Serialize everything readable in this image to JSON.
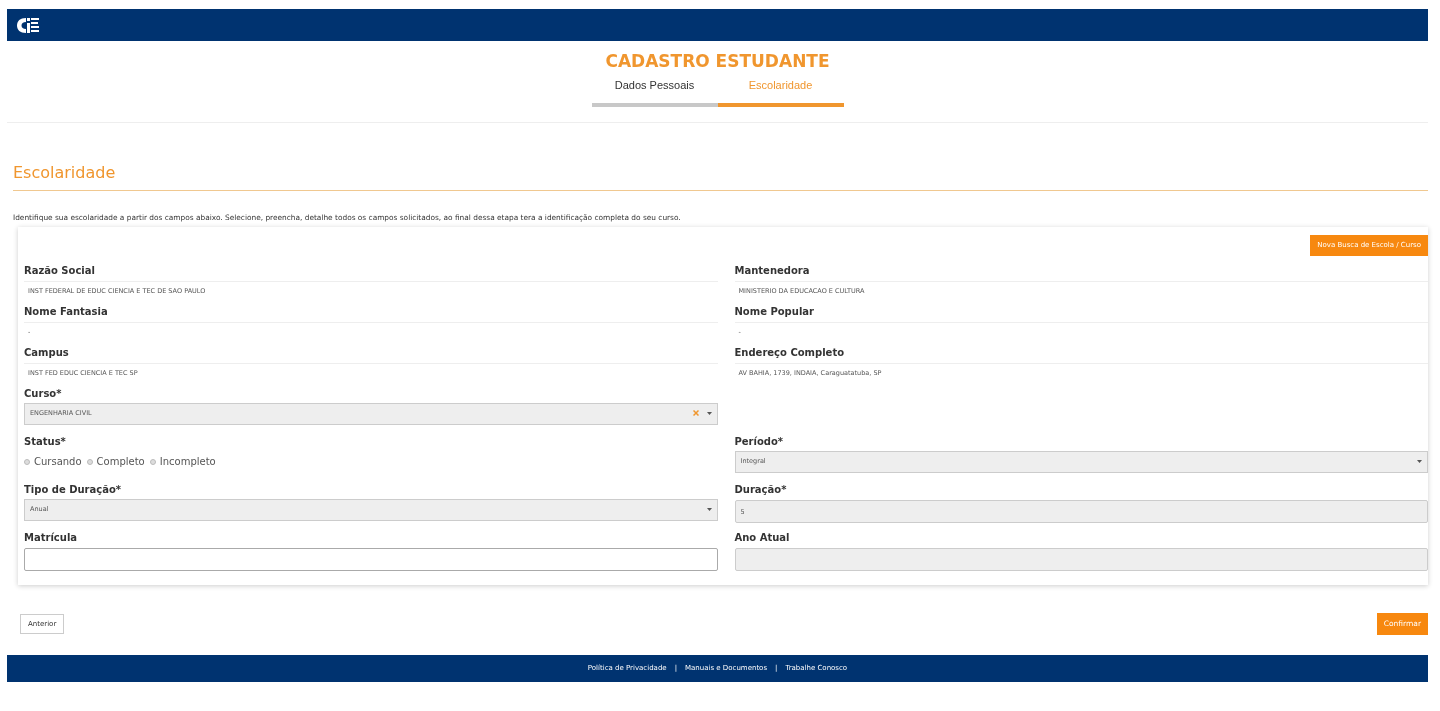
{
  "title": "CADASTRO ESTUDANTE",
  "steps": [
    {
      "label": "Dados Pessoais",
      "selected": false
    },
    {
      "label": "Escolaridade",
      "selected": true
    }
  ],
  "section_title": "Escolaridade",
  "intro": "Identifique sua escolaridade a partir dos campos abaixo. Selecione, preencha, detalhe todos os campos solicitados, ao final dessa etapa tera a identificação completa do seu curso.",
  "search_button": "Nova Busca de Escola / Curso",
  "rows": [
    [
      {
        "kind": "info",
        "label": "Razão Social",
        "value": "INST FEDERAL DE EDUC CIENCIA E TEC DE SAO PAULO"
      },
      {
        "kind": "info",
        "label": "Mantenedora",
        "value": "MINISTERIO DA EDUCACAO E CULTURA"
      }
    ],
    [
      {
        "kind": "info",
        "label": "Nome Fantasia",
        "value": "-"
      },
      {
        "kind": "info",
        "label": "Nome Popular",
        "value": "-"
      }
    ],
    [
      {
        "kind": "info",
        "label": "Campus",
        "value": "INST FED EDUC CIENCIA E TEC SP"
      },
      {
        "kind": "info",
        "label": "Endereço Completo",
        "value": "AV BAHIA, 1739, INDAIA, Caraguatatuba, SP"
      }
    ],
    [
      {
        "kind": "select",
        "label": "Curso*",
        "value": "ENGENHARIA CIVIL",
        "clearable": true,
        "disabled": true
      },
      null
    ],
    [
      {
        "kind": "radio",
        "label": "Status*",
        "options": [
          {
            "label": "Cursando",
            "selected": false
          },
          {
            "label": "Completo",
            "selected": false
          },
          {
            "label": "Incompleto",
            "selected": false
          }
        ]
      },
      {
        "kind": "select",
        "label": "Período*",
        "value": "Integral",
        "clearable": false,
        "disabled": true
      }
    ],
    [
      {
        "kind": "select",
        "label": "Tipo de Duração*",
        "value": "Anual",
        "clearable": false,
        "disabled": true
      },
      {
        "kind": "input",
        "label": "Duração*",
        "value": "5",
        "disabled": true
      }
    ],
    [
      {
        "kind": "input",
        "label": "Matrícula",
        "disabled": false
      },
      {
        "kind": "input",
        "label": "Ano Atual",
        "disabled": true
      }
    ]
  ],
  "back_button": "Anterior",
  "confirm_button": "Confirmar",
  "footer": {
    "links": [
      "Política de Privacidade",
      "Manuais e Documentos",
      "Trabalhe Conosco"
    ],
    "separator": "|"
  }
}
